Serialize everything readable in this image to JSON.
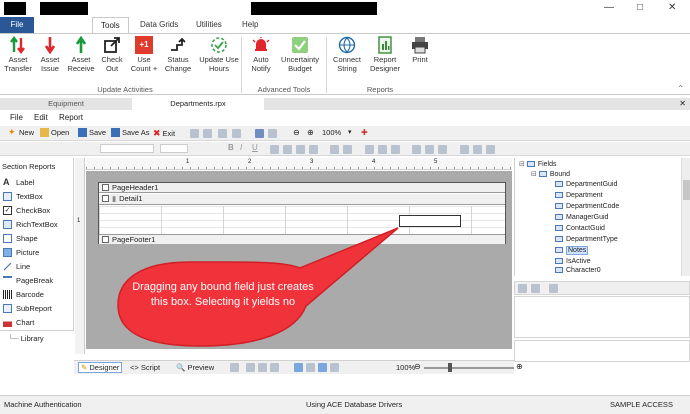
{
  "ribbon_tabs": {
    "file": "File",
    "tools": "Tools",
    "data_grids": "Data Grids",
    "utilities": "Utilities",
    "help": "Help"
  },
  "ribbon": {
    "buttons": [
      {
        "label": "Asset Transfer",
        "icon": "asset-transfer-icon"
      },
      {
        "label": "Asset Issue",
        "icon": "asset-issue-icon"
      },
      {
        "label": "Asset Receive",
        "icon": "asset-receive-icon"
      },
      {
        "label": "Check Out",
        "icon": "check-out-icon"
      },
      {
        "label": "Use Count +",
        "icon": "use-count-icon"
      },
      {
        "label": "Status Change",
        "icon": "status-change-icon"
      },
      {
        "label": "Update Use Hours",
        "icon": "update-use-hours-icon"
      },
      {
        "label": "Auto Notify",
        "icon": "auto-notify-icon"
      },
      {
        "label": "Uncertainty Budget",
        "icon": "uncertainty-budget-icon"
      },
      {
        "label": "Connect String",
        "icon": "connect-string-icon"
      },
      {
        "label": "Report Designer",
        "icon": "report-designer-icon"
      },
      {
        "label": "Print",
        "icon": "print-icon"
      }
    ],
    "groups": {
      "update_activities": "Update Activities",
      "advanced_tools": "Advanced Tools",
      "reports": "Reports"
    },
    "use_count_glyph": "+1"
  },
  "document_tabs": {
    "equipment": "Equipment",
    "departments": "Departments.rpx"
  },
  "menubar": {
    "file": "File",
    "edit": "Edit",
    "report": "Report"
  },
  "toolbar": {
    "new": "New",
    "open": "Open",
    "save": "Save",
    "save_as": "Save As",
    "exit": "Exit",
    "zoom": "100%"
  },
  "toolbar2": {
    "bold": "B",
    "italic": "I",
    "underline": "U"
  },
  "toolbox": {
    "title": "Section Reports",
    "items": [
      "Label",
      "TextBox",
      "CheckBox",
      "RichTextBox",
      "Shape",
      "Picture",
      "Line",
      "PageBreak",
      "Barcode",
      "SubReport",
      "Chart"
    ],
    "library": "Library"
  },
  "ruler": {
    "h_ticks": [
      "1",
      "2",
      "3",
      "4",
      "5"
    ],
    "v_ticks": [
      "1"
    ]
  },
  "report": {
    "page_header": "PageHeader1",
    "detail": "Detail1",
    "page_footer": "PageFooter1"
  },
  "callout": {
    "text": "Dragging any bound field just creates this box. Selecting it yields no",
    "color": "#f0333a"
  },
  "field_tree": {
    "root": "Fields",
    "bound": "Bound",
    "fields": [
      "DepartmentGuid",
      "Department",
      "DepartmentCode",
      "ManagerGuid",
      "ContactGuid",
      "DepartmentType",
      "Notes",
      "IsActive",
      "Character0"
    ],
    "selected": "Notes"
  },
  "bottom_tabs": {
    "designer": "Designer",
    "script": "Script",
    "preview": "Preview",
    "zoom": "100%"
  },
  "status": {
    "left": "Machine Authentication",
    "center": "Using ACE Database Drivers",
    "right": "SAMPLE ACCESS"
  },
  "colors": {
    "file_tab": "#2b5797",
    "callout": "#f0333a",
    "selection": "#cde3ff"
  }
}
